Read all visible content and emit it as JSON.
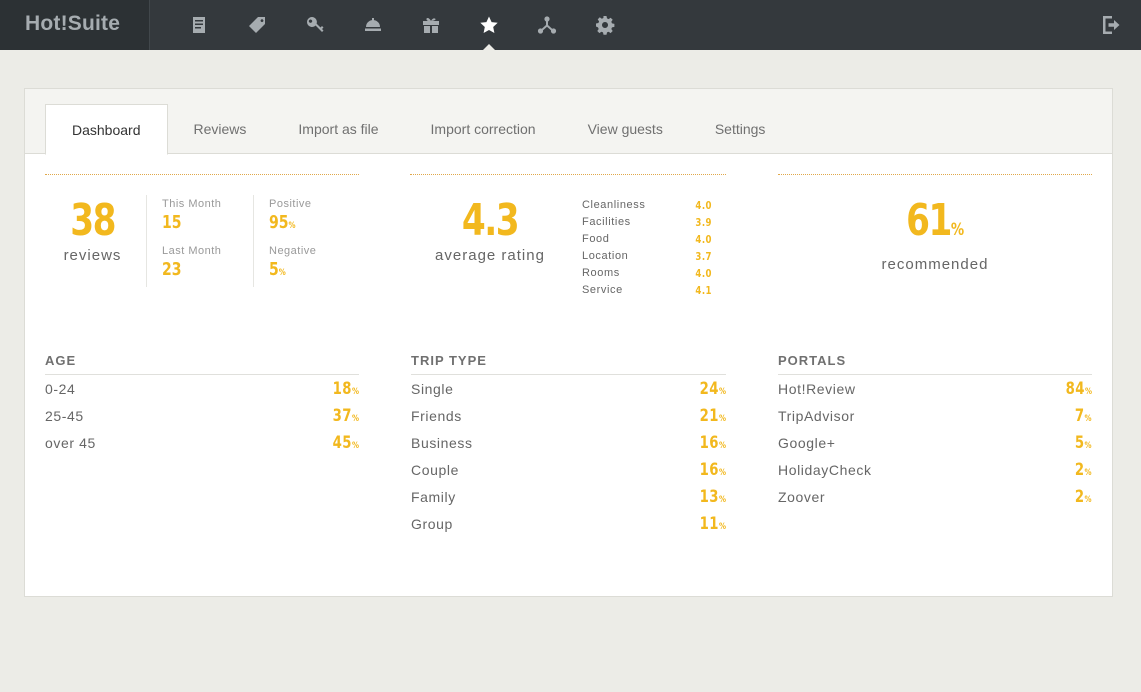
{
  "app": {
    "logo": "Hot!Suite"
  },
  "nav": {
    "icons": [
      "document-icon",
      "tag-icon",
      "key-icon",
      "service-bell-icon",
      "gift-icon",
      "star-icon",
      "network-icon",
      "gear-icon"
    ],
    "active_index": 5,
    "logout_icon": "logout-icon"
  },
  "tabs": [
    "Dashboard",
    "Reviews",
    "Import as file",
    "Import correction",
    "View guests",
    "Settings"
  ],
  "active_tab": "Dashboard",
  "reviews": {
    "count": "38",
    "label": "reviews",
    "this_month_label": "This Month",
    "this_month": "15",
    "last_month_label": "Last Month",
    "last_month": "23",
    "positive_label": "Positive",
    "positive": "95",
    "negative_label": "Negative",
    "negative": "5",
    "percent_sign": "%"
  },
  "rating": {
    "value": "4.3",
    "label": "average rating",
    "items": [
      {
        "name": "Cleanliness",
        "value": "4.0"
      },
      {
        "name": "Facilities",
        "value": "3.9"
      },
      {
        "name": "Food",
        "value": "4.0"
      },
      {
        "name": "Location",
        "value": "3.7"
      },
      {
        "name": "Rooms",
        "value": "4.0"
      },
      {
        "name": "Service",
        "value": "4.1"
      }
    ]
  },
  "recommended": {
    "value": "61",
    "unit": "%",
    "label": "recommended"
  },
  "age": {
    "title": "AGE",
    "rows": [
      {
        "label": "0-24",
        "value": "18"
      },
      {
        "label": "25-45",
        "value": "37"
      },
      {
        "label": "over 45",
        "value": "45"
      }
    ]
  },
  "trip_type": {
    "title": "TRIP TYPE",
    "rows": [
      {
        "label": "Single",
        "value": "24"
      },
      {
        "label": "Friends",
        "value": "21"
      },
      {
        "label": "Business",
        "value": "16"
      },
      {
        "label": "Couple",
        "value": "16"
      },
      {
        "label": "Family",
        "value": "13"
      },
      {
        "label": "Group",
        "value": "11"
      }
    ]
  },
  "portals": {
    "title": "PORTALS",
    "rows": [
      {
        "label": "Hot!Review",
        "value": "84"
      },
      {
        "label": "TripAdvisor",
        "value": "7"
      },
      {
        "label": "Google+",
        "value": "5"
      },
      {
        "label": "HolidayCheck",
        "value": "2"
      },
      {
        "label": "Zoover",
        "value": "2"
      }
    ]
  },
  "colors": {
    "accent": "#f2b81e",
    "topbar": "#34393d",
    "background": "#ecece7"
  }
}
